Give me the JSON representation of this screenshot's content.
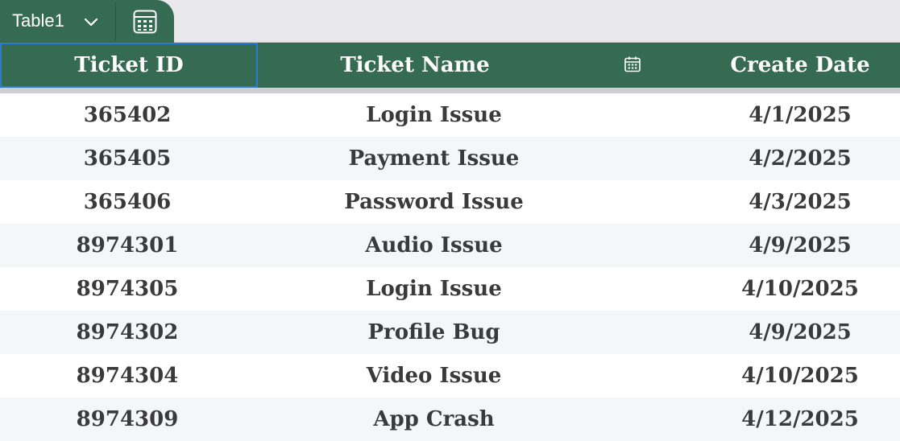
{
  "tab": {
    "name": "Table1",
    "dropdown_icon": "chevron-down-icon",
    "calc_icon": "calculator-icon"
  },
  "columns": [
    "Ticket ID",
    "Ticket Name",
    "Create Date"
  ],
  "column_icons": {
    "Create Date": "calendar-icon"
  },
  "rows": [
    [
      "365402",
      "Login Issue",
      "4/1/2025"
    ],
    [
      "365405",
      "Payment Issue",
      "4/2/2025"
    ],
    [
      "365406",
      "Password Issue",
      "4/3/2025"
    ],
    [
      "8974301",
      "Audio Issue",
      "4/9/2025"
    ],
    [
      "8974305",
      "Login Issue",
      "4/10/2025"
    ],
    [
      "8974302",
      "Profile Bug",
      "4/9/2025"
    ],
    [
      "8974304",
      "Video Issue",
      "4/10/2025"
    ],
    [
      "8974309",
      "App Crash",
      "4/12/2025"
    ]
  ],
  "colors": {
    "header": "#356a53",
    "header_text": "#ffffff",
    "row_alt": "#f5f6f8",
    "cell_text": "#3a3a3a",
    "selection": "#2a7bd6"
  }
}
